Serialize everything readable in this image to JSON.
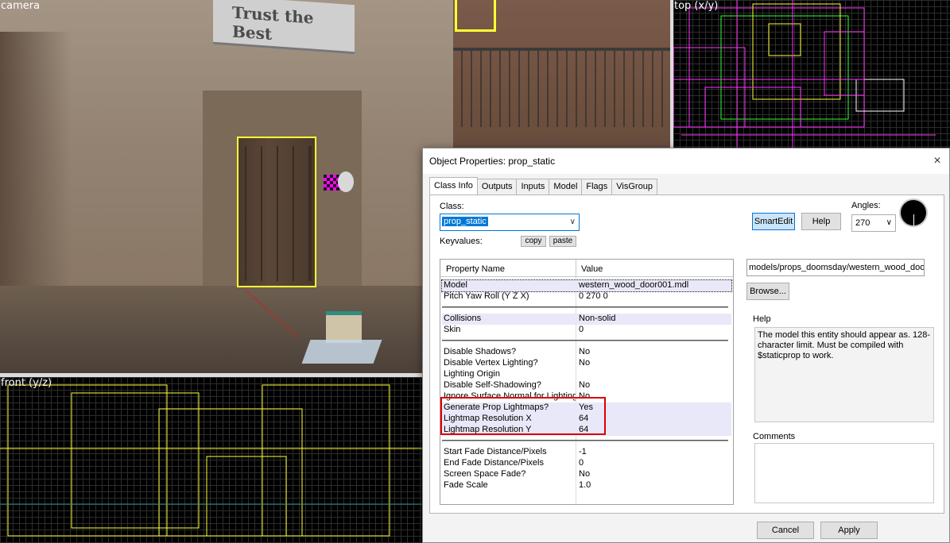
{
  "viewports": {
    "camera_label": "camera",
    "top_label": "top (x/y)",
    "front_label": "front (y/z)",
    "scene": {
      "sign_text": "Trust the Best"
    }
  },
  "dialog": {
    "title": "Object Properties: prop_static",
    "close_icon": "×",
    "tabs": [
      {
        "label": "Class Info",
        "active": true
      },
      {
        "label": "Outputs"
      },
      {
        "label": "Inputs"
      },
      {
        "label": "Model"
      },
      {
        "label": "Flags"
      },
      {
        "label": "VisGroup"
      }
    ],
    "class_label": "Class:",
    "class_value": "prop_static",
    "keyvalues_label": "Keyvalues:",
    "copy_label": "copy",
    "paste_label": "paste",
    "smartedit_label": "SmartEdit",
    "help_button_label": "Help",
    "angles_label": "Angles:",
    "angles_value": "270",
    "grid_header": {
      "name": "Property Name",
      "value": "Value"
    },
    "groups": [
      [
        {
          "k": "Model",
          "v": "western_wood_door001.mdl",
          "selected": true
        },
        {
          "k": "Pitch Yaw Roll (Y Z X)",
          "v": "0 270 0"
        }
      ],
      [
        {
          "k": "Collisions",
          "v": "Non-solid"
        },
        {
          "k": "Skin",
          "v": "0"
        }
      ],
      [
        {
          "k": "Disable Shadows?",
          "v": "No"
        },
        {
          "k": "Disable Vertex Lighting?",
          "v": "No"
        },
        {
          "k": "Lighting Origin",
          "v": ""
        },
        {
          "k": "Disable Self-Shadowing?",
          "v": "No"
        },
        {
          "k": "Ignore Surface Normal for Lighting?",
          "v": "No"
        },
        {
          "k": "Generate Prop Lightmaps?",
          "v": "Yes"
        },
        {
          "k": "Lightmap Resolution X",
          "v": "64"
        },
        {
          "k": "Lightmap Resolution Y",
          "v": "64"
        }
      ],
      [
        {
          "k": "Start Fade Distance/Pixels",
          "v": "-1"
        },
        {
          "k": "End Fade Distance/Pixels",
          "v": "0"
        },
        {
          "k": "Screen Space Fade?",
          "v": "No"
        },
        {
          "k": "Fade Scale",
          "v": "1.0"
        }
      ]
    ],
    "value_field": "models/props_doomsday/western_wood_door",
    "browse_label": "Browse...",
    "help_group_label": "Help",
    "help_text": "The model this entity should appear as. 128-character limit. Must be compiled with $staticprop to work.",
    "comments_label": "Comments",
    "cancel_label": "Cancel",
    "apply_label": "Apply"
  }
}
